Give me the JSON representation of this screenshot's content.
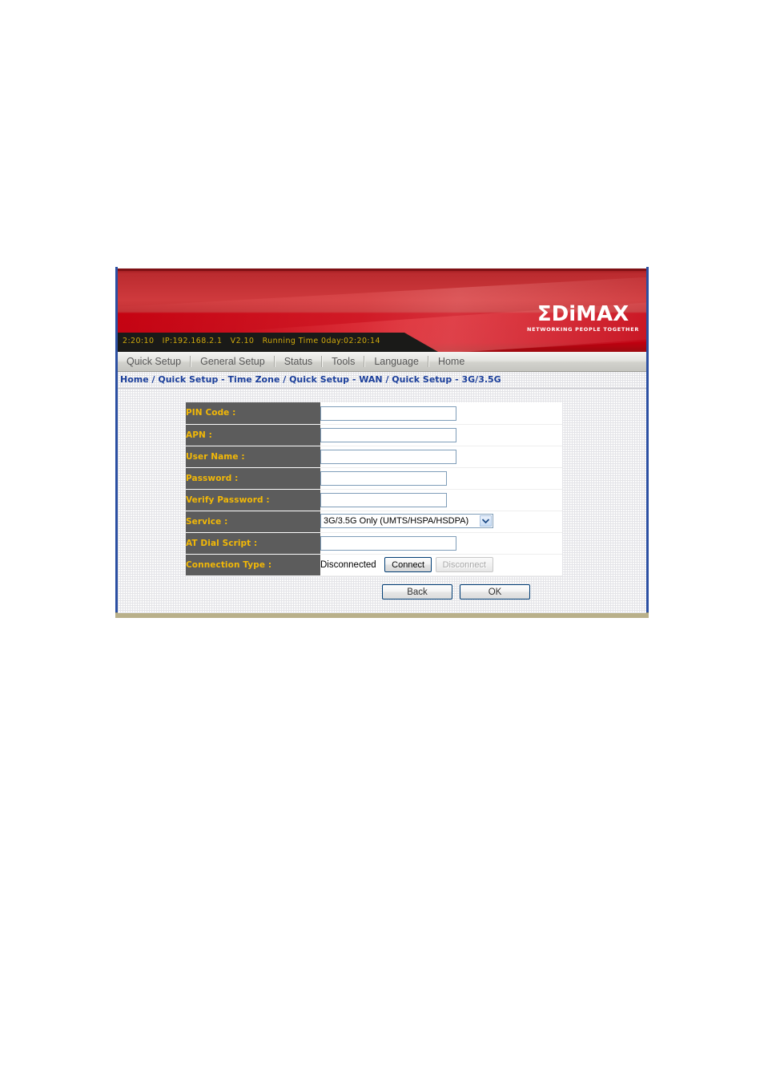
{
  "device": {
    "status_bar": "2:20:10   IP:192.168.2.1   V2.10   Running Time 0day:02:20:14",
    "logo_word_1": "ΣD",
    "logo_word_i": "i",
    "logo_word_2": "MAX",
    "logo_tagline": "NETWORKING PEOPLE TOGETHER"
  },
  "nav": {
    "items": [
      {
        "label": "Quick Setup"
      },
      {
        "label": "General Setup"
      },
      {
        "label": "Status"
      },
      {
        "label": "Tools"
      },
      {
        "label": "Language"
      },
      {
        "label": "Home"
      }
    ]
  },
  "breadcrumb": {
    "text": "Home / Quick Setup - Time Zone / Quick Setup - WAN / Quick Setup - 3G/3.5G"
  },
  "form": {
    "rows": [
      {
        "label": "PIN Code :",
        "value": "",
        "type": "text"
      },
      {
        "label": "APN :",
        "value": "",
        "type": "text"
      },
      {
        "label": "User Name :",
        "value": "",
        "type": "text"
      },
      {
        "label": "Password :",
        "value": "",
        "type": "password"
      },
      {
        "label": "Verify Password :",
        "value": "",
        "type": "password"
      },
      {
        "label": "Service :",
        "value": "3G/3.5G Only (UMTS/HSPA/HSDPA)",
        "type": "select"
      },
      {
        "label": "AT Dial Script :",
        "value": "",
        "type": "text"
      },
      {
        "label": "Connection Type :",
        "value": "Disconnected",
        "type": "connection"
      }
    ],
    "service_options": [
      "3G/3.5G Only (UMTS/HSPA/HSDPA)"
    ],
    "connection": {
      "status": "Disconnected",
      "connect_label": "Connect",
      "disconnect_label": "Disconnect"
    }
  },
  "buttons": {
    "back_label": "Back",
    "ok_label": "OK"
  },
  "colors": {
    "banner_red": "#c00010",
    "label_bg": "#5c5c5c",
    "label_text": "#f2b807",
    "breadcrumb_text": "#1b3f9b",
    "page_border": "#2b4fa2"
  }
}
